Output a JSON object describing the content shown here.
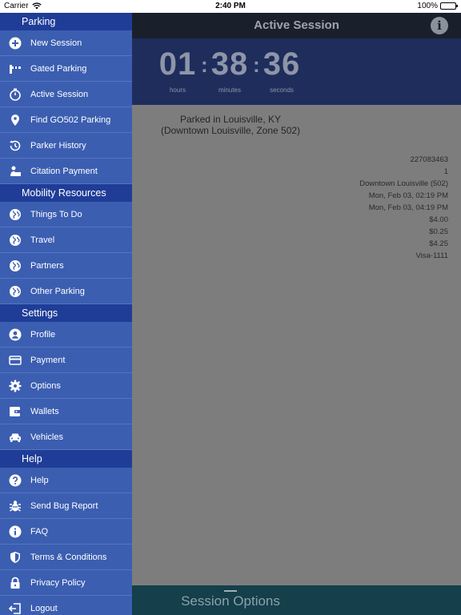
{
  "status_bar": {
    "carrier": "Carrier",
    "time": "2:40 PM",
    "battery": "100%"
  },
  "sidebar": {
    "sections": [
      {
        "title": "Parking",
        "items": [
          {
            "label": "New Session",
            "icon": "plus-circle-icon"
          },
          {
            "label": "Gated Parking",
            "icon": "gate-icon"
          },
          {
            "label": "Active Session",
            "icon": "stopwatch-icon"
          },
          {
            "label": "Find GO502 Parking",
            "icon": "map-pin-icon"
          },
          {
            "label": "Parker History",
            "icon": "history-icon"
          },
          {
            "label": "Citation Payment",
            "icon": "citation-icon"
          }
        ]
      },
      {
        "title": "Mobility Resources",
        "items": [
          {
            "label": "Things To Do",
            "icon": "globe-icon"
          },
          {
            "label": "Travel",
            "icon": "globe-icon"
          },
          {
            "label": "Partners",
            "icon": "globe-icon"
          },
          {
            "label": "Other Parking",
            "icon": "globe-icon"
          }
        ]
      },
      {
        "title": "Settings",
        "items": [
          {
            "label": "Profile",
            "icon": "user-icon"
          },
          {
            "label": "Payment",
            "icon": "credit-card-icon"
          },
          {
            "label": "Options",
            "icon": "gear-icon"
          },
          {
            "label": "Wallets",
            "icon": "wallet-icon"
          },
          {
            "label": "Vehicles",
            "icon": "car-icon"
          }
        ]
      },
      {
        "title": "Help",
        "items": [
          {
            "label": "Help",
            "icon": "question-icon"
          },
          {
            "label": "Send Bug Report",
            "icon": "bug-icon"
          },
          {
            "label": "FAQ",
            "icon": "info-icon"
          },
          {
            "label": "Terms & Conditions",
            "icon": "shield-icon"
          },
          {
            "label": "Privacy Policy",
            "icon": "lock-icon"
          },
          {
            "label": "Logout",
            "icon": "logout-icon"
          }
        ]
      }
    ]
  },
  "main": {
    "title": "Active Session",
    "info_icon": "info-icon",
    "timer": {
      "hours": "01",
      "hours_label": "hours",
      "minutes": "38",
      "minutes_label": "minutes",
      "seconds": "36",
      "seconds_label": "seconds"
    },
    "location": {
      "line1": "Parked in Louisville, KY",
      "line2": "(Downtown Louisville, Zone 502)"
    },
    "details": [
      "227083463",
      "1",
      "Downtown Louisville (502)",
      "Mon, Feb 03, 02:19 PM",
      "Mon, Feb 03, 04:19 PM",
      "$4.00",
      "$0.25",
      "$4.25",
      "Visa-1111"
    ],
    "session_options": "Session Options"
  },
  "colors": {
    "sidebar_bg": "#3b5eb1",
    "section_header_bg": "#1f3d97",
    "timer_bg": "#1e2d5c",
    "bottom_bar_bg": "#143f4b"
  }
}
